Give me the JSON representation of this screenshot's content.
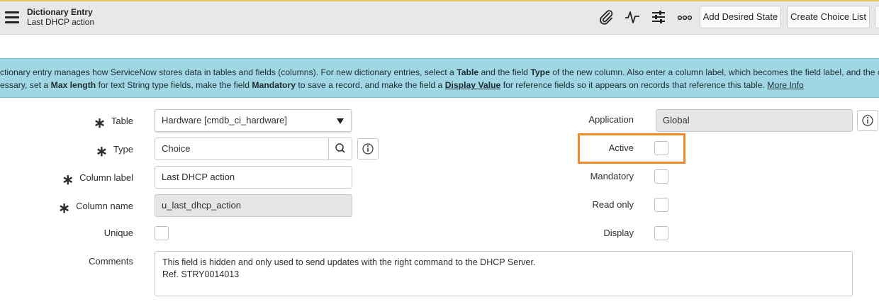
{
  "header": {
    "title": "Dictionary Entry",
    "subtitle": "Last DHCP action",
    "buttons": {
      "add_desired_state": "Add Desired State",
      "create_choice_list": "Create Choice List"
    }
  },
  "banner": {
    "line1": [
      {
        "t": "ctionary entry manages how ServiceNow stores data in tables and fields (columns). For new dictionary entries, select a ",
        "s": ""
      },
      {
        "t": "Table",
        "s": "b"
      },
      {
        "t": " and the field ",
        "s": ""
      },
      {
        "t": "Type",
        "s": "b"
      },
      {
        "t": " of the new column. Also enter a column label, which becomes the field label, and the co",
        "s": ""
      }
    ],
    "line2": [
      {
        "t": "essary, set a ",
        "s": ""
      },
      {
        "t": "Max length",
        "s": "b"
      },
      {
        "t": " for text String type fields, make the field ",
        "s": ""
      },
      {
        "t": "Mandatory",
        "s": "b"
      },
      {
        "t": " to save a record, and make the field a ",
        "s": ""
      },
      {
        "t": "Display Value",
        "s": "ul"
      },
      {
        "t": " for reference fields so it appears on records that reference this table. ",
        "s": ""
      },
      {
        "t": "More Info",
        "s": "link"
      }
    ]
  },
  "form": {
    "table": {
      "label": "Table",
      "value": "Hardware [cmdb_ci_hardware]",
      "required": true
    },
    "type": {
      "label": "Type",
      "value": "Choice",
      "required": true
    },
    "column_label": {
      "label": "Column label",
      "value": "Last DHCP action",
      "required": true
    },
    "column_name": {
      "label": "Column name",
      "value": "u_last_dhcp_action",
      "required": true
    },
    "unique": {
      "label": "Unique",
      "checked": false
    },
    "comments": {
      "label": "Comments",
      "value": "This field is hidden and only used to send updates with the right command to the DHCP Server.\nRef. STRY0014013"
    },
    "application": {
      "label": "Application",
      "value": "Global"
    },
    "active": {
      "label": "Active",
      "checked": false
    },
    "mandatory": {
      "label": "Mandatory",
      "checked": false
    },
    "read_only": {
      "label": "Read only",
      "checked": false
    },
    "display": {
      "label": "Display",
      "checked": false
    },
    "required_marker": "∗"
  },
  "colors": {
    "banner_bg": "#9fd8e4",
    "highlight": "#f08a2c",
    "header_bg": "#e6e8ea"
  }
}
